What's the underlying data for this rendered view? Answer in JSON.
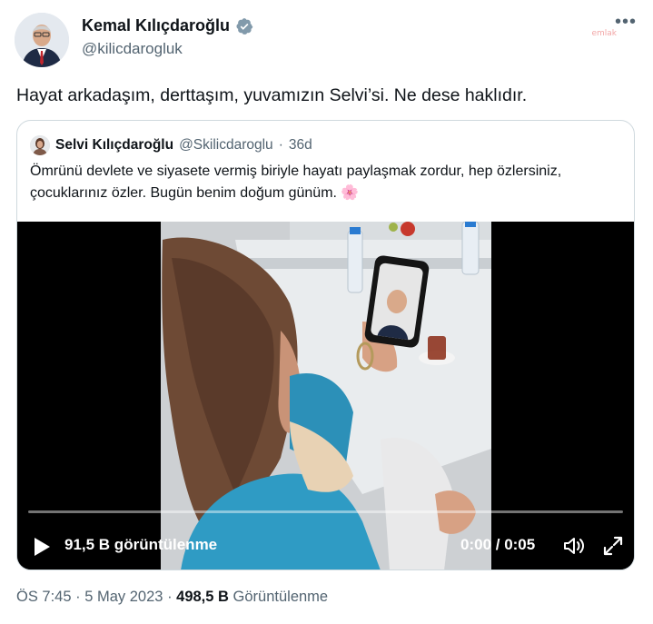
{
  "author": {
    "name": "Kemal Kılıçdaroğlu",
    "handle": "@kilicdarogluk",
    "verified_icon": "verified-badge-icon"
  },
  "watermark": "emlak",
  "more_icon": "more-icon",
  "tweet_text": "Hayat arkadaşım, derttaşım, yuvamızın Selvi’si. Ne dese haklıdır.",
  "quote": {
    "name": "Selvi Kılıçdaroğlu",
    "handle": "@Skilicdaroglu",
    "separator": "·",
    "age": "36d",
    "text": "Ömrünü devlete ve siyasete vermiş biriyle hayatı paylaşmak zordur, hep özlersiniz, çocuklarınız özler. Bugün benim doğum günüm. 🌸"
  },
  "video": {
    "views": "91,5 B görüntülenme",
    "time": "0:00 / 0:05",
    "progress": 0,
    "icons": [
      "play-icon",
      "volume-icon",
      "fullscreen-icon"
    ]
  },
  "footer": {
    "time": "ÖS 7:45",
    "sep1": "·",
    "date": "5 May 2023",
    "sep2": "·",
    "views_count": "498,5 B",
    "views_label": "Görüntülenme"
  },
  "colors": {
    "text": "#0f1419",
    "secondary": "#536471",
    "border": "#cfd9de",
    "verified": "#829aab"
  }
}
